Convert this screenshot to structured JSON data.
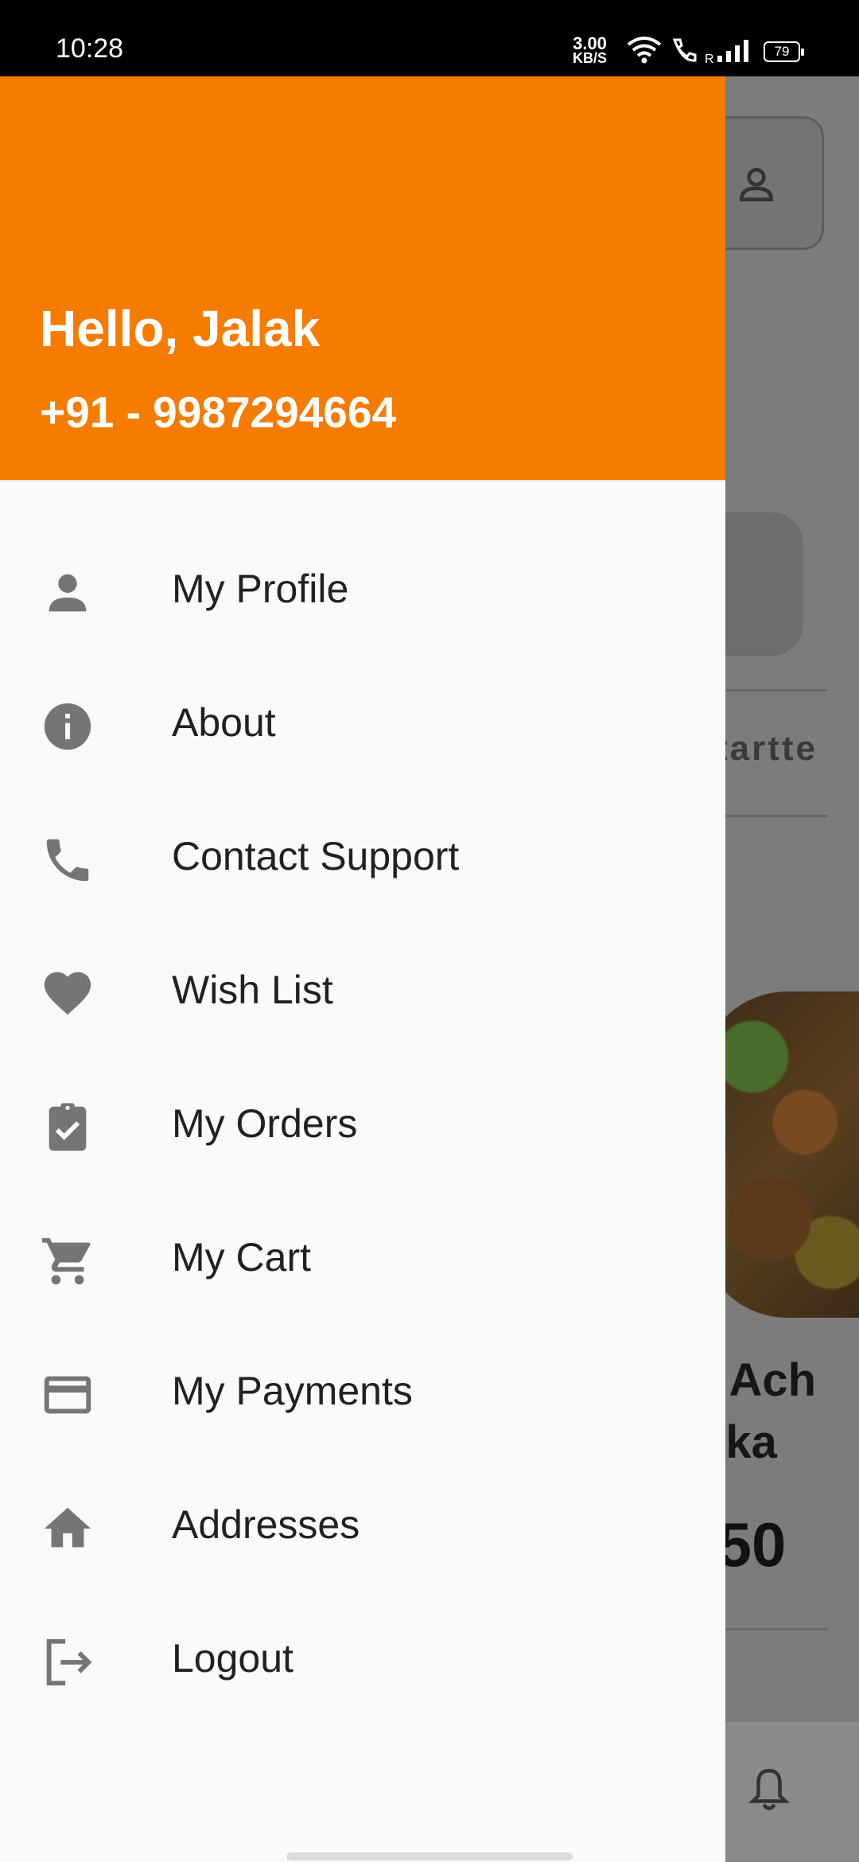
{
  "status_bar": {
    "time": "10:28",
    "net_speed": "3.00",
    "net_unit": "KB/S",
    "roaming": "R",
    "battery": "79"
  },
  "drawer": {
    "greeting": "Hello, Jalak",
    "phone": "+91 - 9987294664",
    "header_color": "#f57c00",
    "items": [
      {
        "label": "My Profile",
        "icon": "person-icon"
      },
      {
        "label": "About",
        "icon": "info-icon"
      },
      {
        "label": "Contact Support",
        "icon": "phone-icon"
      },
      {
        "label": "Wish List",
        "icon": "heart-icon"
      },
      {
        "label": "My Orders",
        "icon": "clipboard-check-icon"
      },
      {
        "label": "My Cart",
        "icon": "cart-icon"
      },
      {
        "label": "My Payments",
        "icon": "credit-card-icon"
      },
      {
        "label": "Addresses",
        "icon": "home-icon"
      },
      {
        "label": "Logout",
        "icon": "logout-icon"
      }
    ]
  },
  "background": {
    "category_fragment": "tartte",
    "item_name_line1": "r Ach",
    "item_name_line2": "kka",
    "price_fragment": ".50"
  }
}
